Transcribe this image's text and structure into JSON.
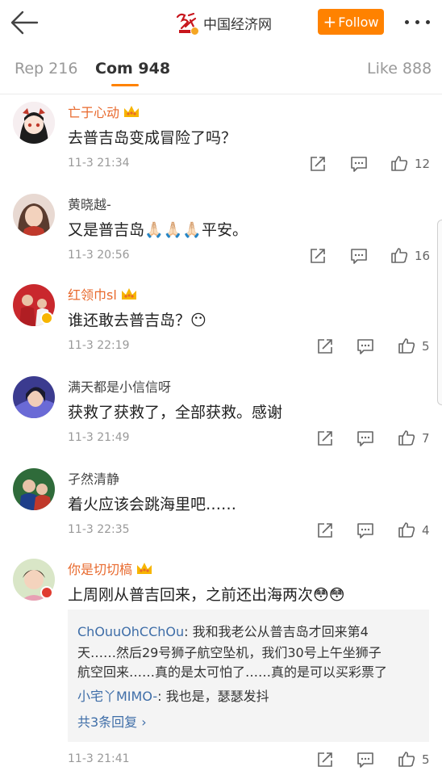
{
  "header": {
    "brand_name": "中国经济网",
    "follow_label": "Follow",
    "follow_plus": "+"
  },
  "tabs": [
    {
      "label": "Rep 216"
    },
    {
      "label": "Com 948"
    },
    {
      "label": "Like 888"
    }
  ],
  "colors": {
    "accent": "#ff8200",
    "vip_name": "#e8692d",
    "link": "#3f6ea8"
  },
  "comments": [
    {
      "user": "亡于心动",
      "vip": true,
      "text": "去普吉岛变成冒险了吗？",
      "time": "11-3 21:34",
      "likes": "12"
    },
    {
      "user": "黄晓越-",
      "vip": false,
      "text": "又是普吉岛🙏🏻🙏🏻🙏🏻平安。",
      "time": "11-3 20:56",
      "likes": "16"
    },
    {
      "user": "红领巾sl",
      "vip": true,
      "text": "谁还敢去普吉岛？😶",
      "time": "11-3 22:19",
      "likes": "5"
    },
    {
      "user": "满天都是小信信呀",
      "vip": false,
      "text": "获救了获救了，全部获救。感谢",
      "time": "11-3 21:49",
      "likes": "7"
    },
    {
      "user": "孑然清静",
      "vip": false,
      "text": "着火应该会跳海里吧……",
      "time": "11-3 22:35",
      "likes": "4"
    },
    {
      "user": "你是切切槁",
      "vip": true,
      "text": "上周刚从普吉回来，之前还出海两次😳😳",
      "time": "11-3 21:41",
      "likes": "5"
    }
  ],
  "replies": [
    {
      "name": "ChOuuOhCChOu",
      "line1": ": 我和我老公从普吉岛才回来第4",
      "line2": "天……然后29号狮子航空坠机，我们30号上午坐狮子",
      "line3": "航空回来……真的是太可怕了……真的是可以买彩票了"
    },
    {
      "name": "小宅丫MIMO-",
      "line1": ": 我也是，瑟瑟发抖"
    }
  ],
  "reply_more": "共3条回复 ›"
}
